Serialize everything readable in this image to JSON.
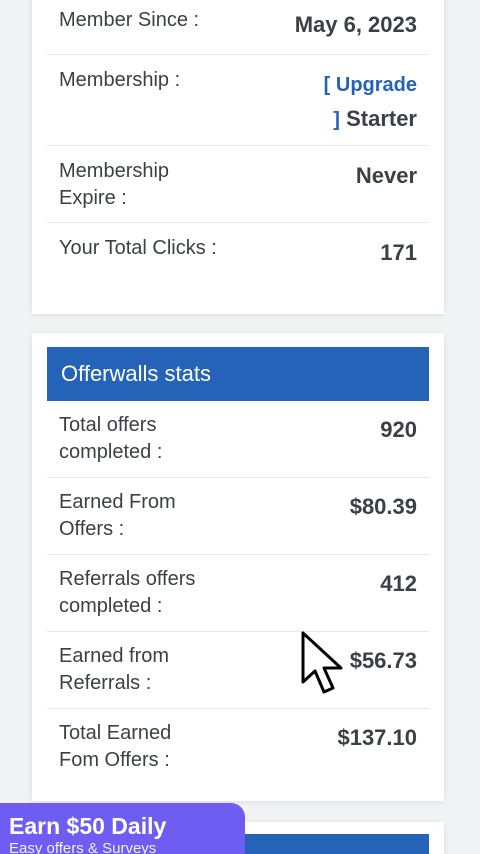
{
  "account": {
    "rows": [
      {
        "label": "Member Since :",
        "value": "May 6, 2023"
      },
      {
        "label": "Membership :",
        "upgrade_label": "[ Upgrade",
        "bracket_close": "]",
        "value": "Starter"
      },
      {
        "label": "Membership Expire :",
        "value": "Never"
      },
      {
        "label": "Your Total Clicks :",
        "value": "171"
      }
    ]
  },
  "offerwalls": {
    "title": "Offerwalls stats",
    "rows": [
      {
        "label": "Total offers completed :",
        "value": "920"
      },
      {
        "label": "Earned From Offers :",
        "value": "$80.39"
      },
      {
        "label": "Referrals offers completed :",
        "value": "412"
      },
      {
        "label": "Earned from Referrals :",
        "value": "$56.73"
      },
      {
        "label": "Total Earned Fom Offers :",
        "value": "$137.10"
      }
    ]
  },
  "promo": {
    "title": "Earn $50 Daily",
    "subtitle": "Easy offers & Surveys"
  },
  "colors": {
    "accent": "#2563b8",
    "promo": "#6f5cf2"
  }
}
